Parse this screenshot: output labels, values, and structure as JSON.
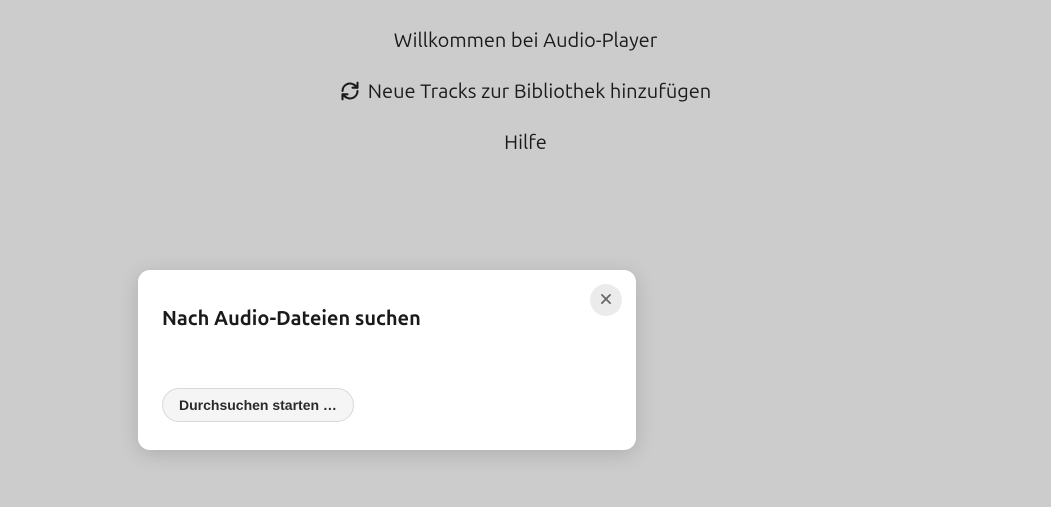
{
  "welcome": {
    "title": "Willkommen bei Audio-Player",
    "add_tracks_label": "Neue Tracks zur Bibliothek hinzufügen",
    "help_label": "Hilfe"
  },
  "dialog": {
    "title": "Nach Audio-Dateien suchen",
    "scan_button_label": "Durchsuchen starten …"
  }
}
